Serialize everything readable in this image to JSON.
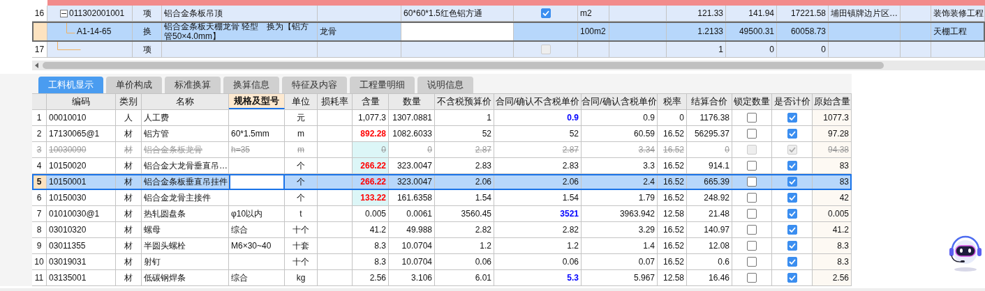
{
  "top_table": {
    "rows": [
      {
        "num": "16",
        "expanded": true,
        "kind": "parent",
        "code": "011302001001",
        "type": "项",
        "name": "铝合金条板吊顶",
        "column_5": "",
        "spec": "60*60*1.5红色铝方通",
        "checked": true,
        "disabled": false,
        "unit": "m2",
        "column_9": "",
        "column_10": "121.33",
        "column_11": "141.94",
        "column_12": "17221.58",
        "column_13": "埔田镇牌边片区…",
        "column_14": "",
        "column_15": "装饰装修工程",
        "selected": false
      },
      {
        "num": "",
        "kind": "child",
        "code": "A1-14-65",
        "type": "换",
        "name": "铝合金条板天棚龙骨 轻型　换为【铝方管50×4.0mm】",
        "column_5": "龙骨",
        "spec": "",
        "unit": "100m2",
        "column_9": "",
        "column_10": "1.2133",
        "column_11": "49500.31",
        "column_12": "60058.73",
        "column_13": "",
        "column_14": "",
        "column_15": "天棚工程",
        "selected": true
      },
      {
        "num": "17",
        "kind": "end",
        "code": "",
        "type": "项",
        "name": "",
        "column_5": "",
        "spec": "",
        "checked": false,
        "disabled": true,
        "unit": "",
        "column_9": "",
        "column_10": "1",
        "column_11": "0",
        "column_12": "0",
        "column_13": "",
        "column_14": "",
        "column_15": "",
        "selected": false
      }
    ]
  },
  "tabs": [
    {
      "label": "工料机显示",
      "selected": true
    },
    {
      "label": "单价构成",
      "selected": false
    },
    {
      "label": "标准换算",
      "selected": false
    },
    {
      "label": "换算信息",
      "selected": false
    },
    {
      "label": "特征及内容",
      "selected": false
    },
    {
      "label": "工程量明细",
      "selected": false
    },
    {
      "label": "说明信息",
      "selected": false
    }
  ],
  "table": {
    "columns": [
      {
        "label": "编码",
        "active": false
      },
      {
        "label": "类别",
        "active": false
      },
      {
        "label": "名称",
        "active": false
      },
      {
        "label": "规格及型号",
        "active": true
      },
      {
        "label": "单位",
        "active": false
      },
      {
        "label": "损耗率",
        "active": false
      },
      {
        "label": "含量",
        "active": false
      },
      {
        "label": "数量",
        "active": false
      },
      {
        "label": "不含税预算价",
        "active": false
      },
      {
        "label": "合同/确认不含税单价",
        "active": false
      },
      {
        "label": "合同/确认含税单价",
        "active": false
      },
      {
        "label": "税率",
        "active": false
      },
      {
        "label": "结算合价",
        "active": false
      },
      {
        "label": "锁定数量",
        "active": false
      },
      {
        "label": "是否计价",
        "active": false
      },
      {
        "label": "原始含量",
        "active": false
      }
    ],
    "rows": [
      {
        "num": "1",
        "code": "00010010",
        "type": "人",
        "name": "人工费",
        "spec": "",
        "unit": "元",
        "loss": "",
        "qty": "1,077.3",
        "amount": "1307.0881",
        "budget": "1",
        "contract": "0.9",
        "contract_tax": "0.9",
        "tax": "0",
        "total": "1176.38",
        "locked": false,
        "priced": true,
        "original": "1077.3",
        "deleted": false,
        "selected": false,
        "qty_edited": false,
        "qty_tinted": false,
        "price_adjusted": true
      },
      {
        "num": "2",
        "code": "17130065@1",
        "type": "材",
        "name": "铝方管",
        "spec": "60*1.5mm",
        "unit": "m",
        "loss": "",
        "qty": "892.28",
        "amount": "1082.6033",
        "budget": "52",
        "contract": "52",
        "contract_tax": "60.59",
        "tax": "16.52",
        "total": "56295.37",
        "locked": false,
        "priced": true,
        "original": "97.28",
        "deleted": false,
        "selected": false,
        "qty_edited": true,
        "qty_tinted": false,
        "price_adjusted": false
      },
      {
        "num": "3",
        "code": "10030090",
        "type": "材",
        "name": "铝合金条板龙骨",
        "spec": "h=35",
        "unit": "m",
        "loss": "",
        "qty": "0",
        "amount": "0",
        "budget": "2.87",
        "contract": "2.87",
        "contract_tax": "3.34",
        "tax": "16.52",
        "total": "0",
        "locked": false,
        "priced": true,
        "original": "94.38",
        "deleted": true,
        "selected": false,
        "qty_edited": false,
        "qty_tinted": true,
        "price_adjusted": false
      },
      {
        "num": "4",
        "code": "10150020",
        "type": "材",
        "name": "铝合金大龙骨垂直吊…",
        "spec": "",
        "unit": "个",
        "loss": "",
        "qty": "266.22",
        "amount": "323.0047",
        "budget": "2.83",
        "contract": "2.83",
        "contract_tax": "3.3",
        "tax": "16.52",
        "total": "914.1",
        "locked": false,
        "priced": true,
        "original": "83",
        "deleted": false,
        "selected": false,
        "qty_edited": true,
        "qty_tinted": true,
        "price_adjusted": false
      },
      {
        "num": "5",
        "code": "10150001",
        "type": "材",
        "name": "铝合金条板垂直吊挂件",
        "spec": "",
        "unit": "个",
        "loss": "",
        "qty": "266.22",
        "amount": "323.0047",
        "budget": "2.06",
        "contract": "2.06",
        "contract_tax": "2.4",
        "tax": "16.52",
        "total": "665.39",
        "locked": false,
        "priced": true,
        "original": "83",
        "deleted": false,
        "selected": true,
        "qty_edited": true,
        "qty_tinted": true,
        "price_adjusted": false
      },
      {
        "num": "6",
        "code": "10150030",
        "type": "材",
        "name": "铝合金龙骨主接件",
        "spec": "",
        "unit": "个",
        "loss": "",
        "qty": "133.22",
        "amount": "161.6358",
        "budget": "1.54",
        "contract": "1.54",
        "contract_tax": "1.79",
        "tax": "16.52",
        "total": "248.92",
        "locked": false,
        "priced": true,
        "original": "42",
        "deleted": false,
        "selected": false,
        "qty_edited": true,
        "qty_tinted": true,
        "price_adjusted": false
      },
      {
        "num": "7",
        "code": "01010030@1",
        "type": "材",
        "name": "热轧圆盘条",
        "spec": "φ10以内",
        "unit": "t",
        "loss": "",
        "qty": "0.005",
        "amount": "0.0061",
        "budget": "3560.45",
        "contract": "3521",
        "contract_tax": "3963.942",
        "tax": "12.58",
        "total": "21.48",
        "locked": false,
        "priced": true,
        "original": "0.005",
        "deleted": false,
        "selected": false,
        "qty_edited": false,
        "qty_tinted": false,
        "price_adjusted": true
      },
      {
        "num": "8",
        "code": "03010320",
        "type": "材",
        "name": "螺母",
        "spec": "综合",
        "unit": "十个",
        "loss": "",
        "qty": "41.2",
        "amount": "49.988",
        "budget": "2.82",
        "contract": "2.82",
        "contract_tax": "3.29",
        "tax": "16.52",
        "total": "140.97",
        "locked": false,
        "priced": true,
        "original": "41.2",
        "deleted": false,
        "selected": false,
        "qty_edited": false,
        "qty_tinted": false,
        "price_adjusted": false
      },
      {
        "num": "9",
        "code": "03011355",
        "type": "材",
        "name": "半圆头螺栓",
        "spec": "M6×30~40",
        "unit": "十套",
        "loss": "",
        "qty": "8.3",
        "amount": "10.0704",
        "budget": "1.2",
        "contract": "1.2",
        "contract_tax": "1.4",
        "tax": "16.52",
        "total": "12.08",
        "locked": false,
        "priced": true,
        "original": "8.3",
        "deleted": false,
        "selected": false,
        "qty_edited": false,
        "qty_tinted": false,
        "price_adjusted": false
      },
      {
        "num": "10",
        "code": "03019031",
        "type": "材",
        "name": "射钉",
        "spec": "",
        "unit": "十个",
        "loss": "",
        "qty": "8.3",
        "amount": "10.0704",
        "budget": "0.06",
        "contract": "0.06",
        "contract_tax": "0.07",
        "tax": "16.52",
        "total": "0.6",
        "locked": false,
        "priced": true,
        "original": "8.3",
        "deleted": false,
        "selected": false,
        "qty_edited": false,
        "qty_tinted": false,
        "price_adjusted": false
      },
      {
        "num": "11",
        "code": "03135001",
        "type": "材",
        "name": "低碳钢焊条",
        "spec": "综合",
        "unit": "kg",
        "loss": "",
        "qty": "2.56",
        "amount": "3.106",
        "budget": "6.01",
        "contract": "5.3",
        "contract_tax": "5.967",
        "tax": "12.58",
        "total": "16.46",
        "locked": false,
        "priced": true,
        "original": "2.56",
        "deleted": false,
        "selected": false,
        "qty_edited": false,
        "qty_tinted": false,
        "price_adjusted": true
      }
    ]
  }
}
